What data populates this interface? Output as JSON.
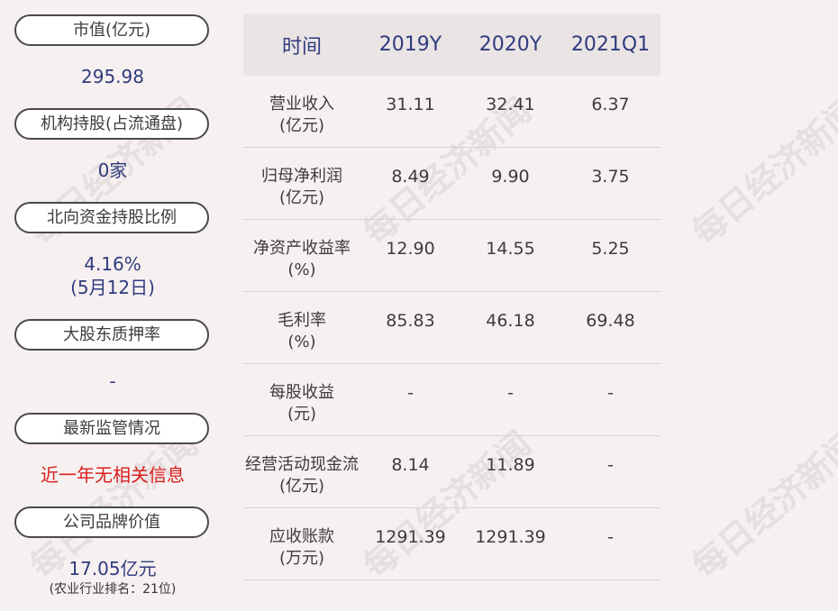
{
  "watermark": "每日经济新闻",
  "left_panel": [
    {
      "label": "市值(亿元)",
      "value": "295.98"
    },
    {
      "label": "机构持股(占流通盘)",
      "value": "0家"
    },
    {
      "label": "北向资金持股比例",
      "value": "4.16%",
      "value2": "(5月12日)"
    },
    {
      "label": "大股东质押率",
      "value": "-"
    },
    {
      "label": "最新监管情况",
      "value": "近一年无相关信息"
    },
    {
      "label": "公司品牌价值",
      "value": "17.05亿元",
      "note": "(农业行业排名：21位)"
    }
  ],
  "table": {
    "headers": [
      "时间",
      "2019Y",
      "2020Y",
      "2021Q1"
    ],
    "rows": [
      {
        "name": "营业收入",
        "unit": "(亿元)",
        "values": [
          "31.11",
          "32.41",
          "6.37"
        ]
      },
      {
        "name": "归母净利润",
        "unit": "(亿元)",
        "values": [
          "8.49",
          "9.90",
          "3.75"
        ]
      },
      {
        "name": "净资产收益率",
        "unit": "(%)",
        "values": [
          "12.90",
          "14.55",
          "5.25"
        ]
      },
      {
        "name": "毛利率",
        "unit": "(%)",
        "values": [
          "85.83",
          "46.18",
          "69.48"
        ]
      },
      {
        "name": "每股收益",
        "unit": "(元)",
        "values": [
          "-",
          "-",
          "-"
        ]
      },
      {
        "name": "经营活动现金流",
        "unit": "(亿元)",
        "values": [
          "8.14",
          "11.89",
          "-"
        ]
      },
      {
        "name": "应收账款",
        "unit": "(万元)",
        "values": [
          "1291.39",
          "1291.39",
          "-"
        ]
      }
    ]
  }
}
